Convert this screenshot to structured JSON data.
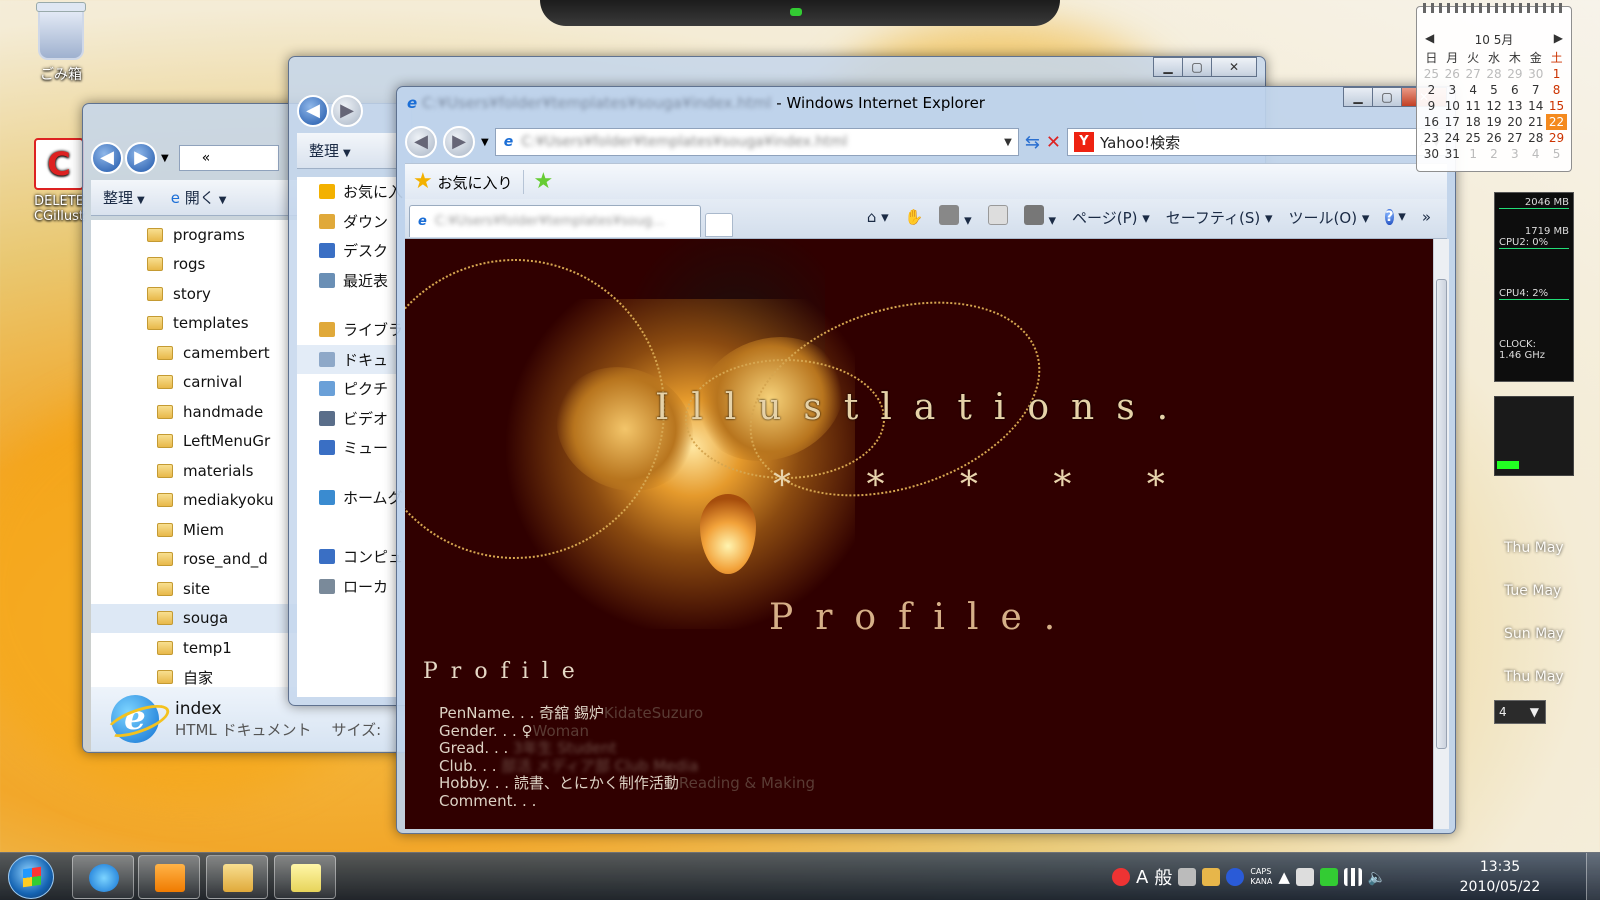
{
  "desktop": {
    "recycle_bin_label": "ごみ箱",
    "cg_icon_label_1": "DELETE",
    "cg_icon_label_2": "CGillust"
  },
  "explorer_back": {
    "cmd_organize": "整理",
    "cmd_open": "開く",
    "breadcrumb": "«",
    "folders": [
      "programs",
      "rogs",
      "story",
      "templates",
      "camembert",
      "carnival",
      "handmade",
      "LeftMenuGr",
      "materials",
      "mediakyoku",
      "Miem",
      "rose_and_d",
      "site",
      "souga",
      "temp1",
      "自家"
    ],
    "selected_folder": "souga",
    "details_name": "index",
    "details_type": "HTML ドキュメント",
    "details_size_label": "サイズ:"
  },
  "explorer_mid": {
    "cmd_organize": "整理",
    "nav_items": [
      "お気に入",
      "ダウン",
      "デスク",
      "最近表",
      "ライブラ",
      "ドキュ",
      "ピクチ",
      "ビデオ",
      "ミュー",
      "ホームグ",
      "コンピュ",
      "ローカ"
    ]
  },
  "ie": {
    "title": "Windows Internet Explorer",
    "title_url_blurred": "C:¥Users¥folder¥templates¥souga¥index.html",
    "address_blurred": "C:¥Users¥folder¥templates¥souga¥index.html",
    "search_text": "Yahoo!検索",
    "favorites_label": "お気に入り",
    "tab_title_blurred": "C:¥Users¥folder¥templates¥soug...",
    "menu_page": "ページ(P)",
    "menu_safety": "セーフティ(S)",
    "menu_tools": "ツール(O)"
  },
  "page": {
    "title": "Illustlations.",
    "stars": "* * * * *",
    "profile_heading": "Profile.",
    "profile_small": "Profile",
    "lines": [
      {
        "label": "PenName. . . ",
        "value": "奇舘 錫炉",
        "faint": "KidateSuzuro"
      },
      {
        "label": "Gender. . . ",
        "value": "♀",
        "faint": "Woman"
      },
      {
        "label": "Gread. . . ",
        "value": "",
        "faint": "",
        "blurred": "3年生 Student"
      },
      {
        "label": "Club. . . ",
        "value": "",
        "faint": "",
        "blurred": "部活 メディア部 Club Media"
      },
      {
        "label": "Hobby. . . ",
        "value": "読書、とにかく制作活動",
        "faint": "Reading & Making"
      },
      {
        "label": "Comment. . . ",
        "value": "",
        "faint": ""
      }
    ]
  },
  "calendar": {
    "header": "10 5月",
    "weekdays": [
      "日",
      "月",
      "火",
      "水",
      "木",
      "金",
      "土"
    ],
    "days": [
      [
        "25",
        "26",
        "27",
        "28",
        "29",
        "30",
        "1"
      ],
      [
        "2",
        "3",
        "4",
        "5",
        "6",
        "7",
        "8"
      ],
      [
        "9",
        "10",
        "11",
        "12",
        "13",
        "14",
        "15"
      ],
      [
        "16",
        "17",
        "18",
        "19",
        "20",
        "21",
        "22"
      ],
      [
        "23",
        "24",
        "25",
        "26",
        "27",
        "28",
        "29"
      ],
      [
        "30",
        "31",
        "1",
        "2",
        "3",
        "4",
        "5"
      ]
    ],
    "today": "22"
  },
  "meter": {
    "mem_total": "2046 MB",
    "mem_used": "1719 MB",
    "cpu2": "CPU2:   0%",
    "cpu4": "CPU4:   2%",
    "clock_label": "CLOCK:",
    "clock_value": "1.46 GHz"
  },
  "weekday_gadget": [
    "Thu May",
    "Tue May",
    "Sun May",
    "Thu May"
  ],
  "combo_value": "4",
  "taskbar": {
    "ime_a": "A",
    "ime_mode": "般",
    "caps": "CAPS",
    "kana": "KANA",
    "time": "13:35",
    "date": "2010/05/22"
  }
}
